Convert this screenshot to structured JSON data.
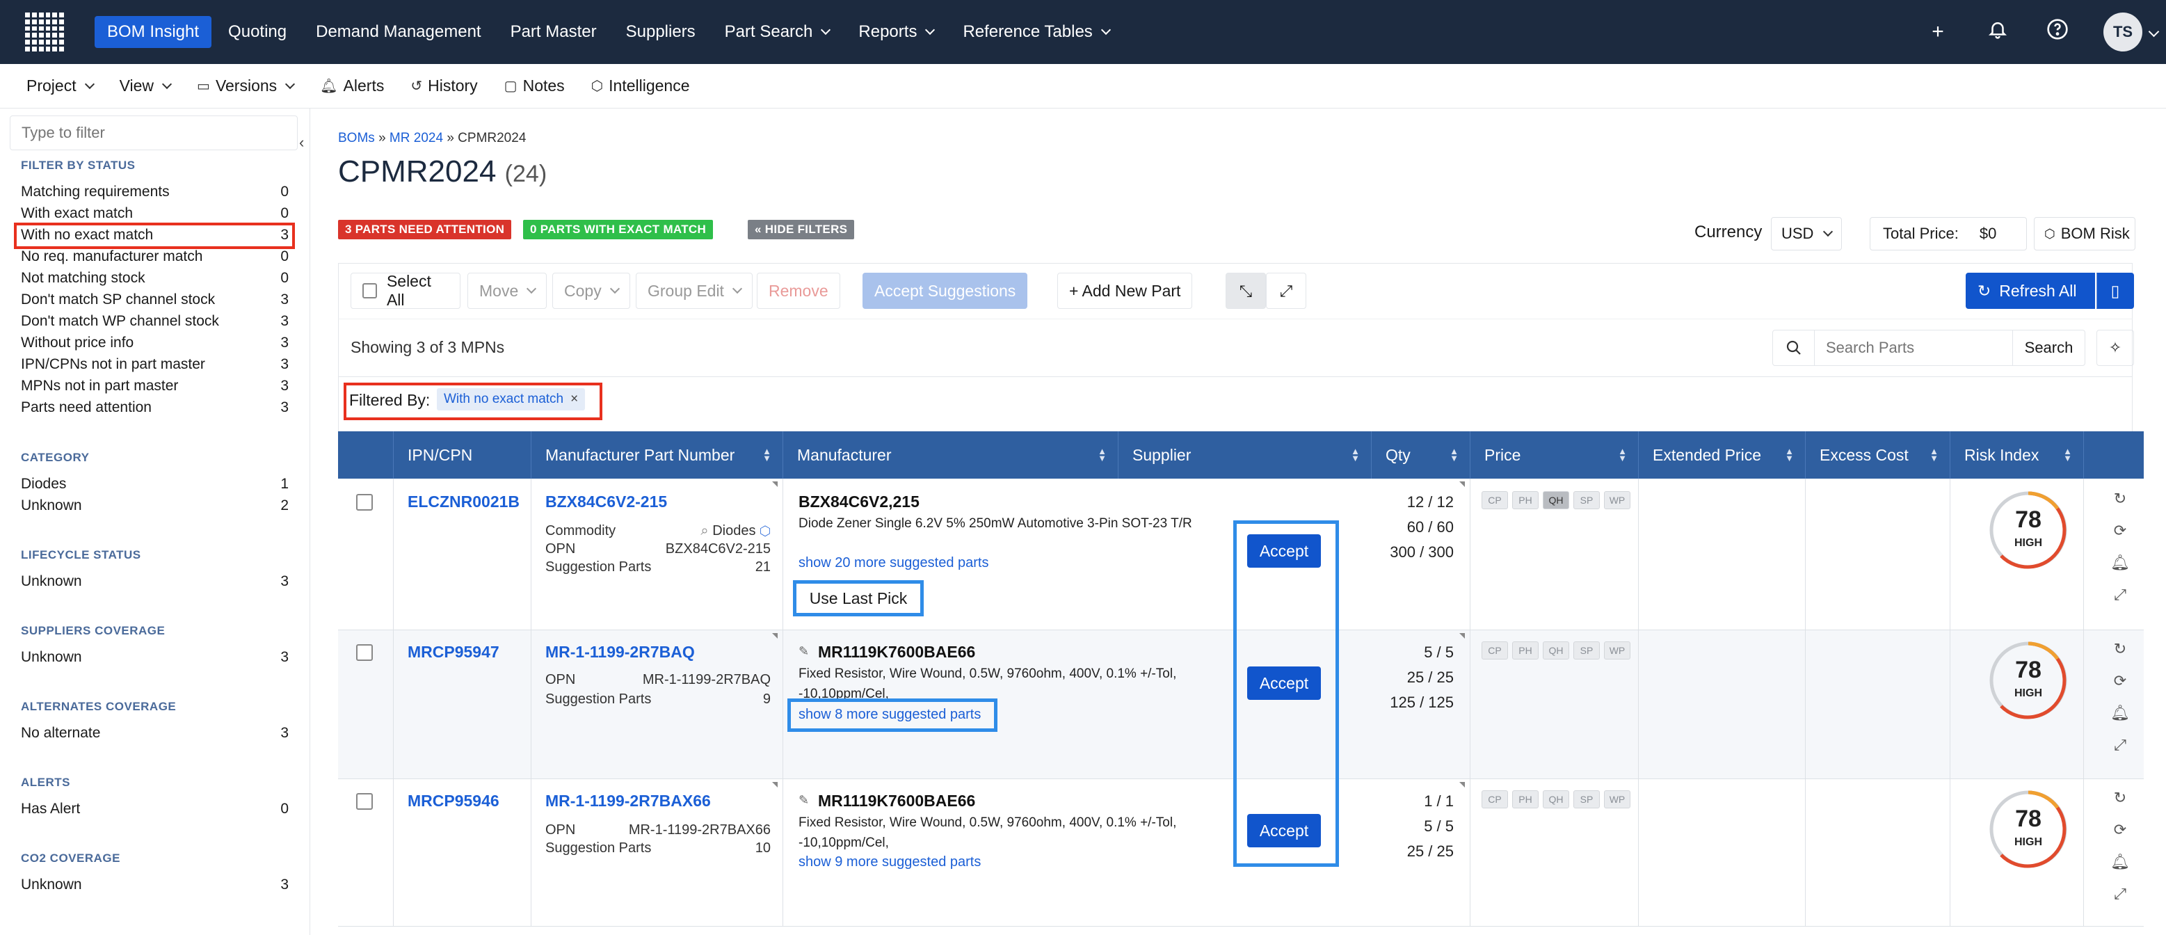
{
  "nav": {
    "items": [
      {
        "label": "BOM Insight",
        "active": true
      },
      {
        "label": "Quoting"
      },
      {
        "label": "Demand Management"
      },
      {
        "label": "Part Master"
      },
      {
        "label": "Suppliers"
      },
      {
        "label": "Part Search",
        "dropdown": true
      },
      {
        "label": "Reports",
        "dropdown": true
      },
      {
        "label": "Reference Tables",
        "dropdown": true
      }
    ],
    "avatar": "TS",
    "colors": {
      "bg": "#1c2a3f",
      "active": "#1b5fd6"
    }
  },
  "subnav": {
    "project": "Project",
    "view": "View",
    "versions": "Versions",
    "alerts": "Alerts",
    "history": "History",
    "notes": "Notes",
    "intelligence": "Intelligence"
  },
  "sidebar": {
    "filter_placeholder": "Type to filter",
    "status_title": "FILTER BY STATUS",
    "status": [
      {
        "label": "Matching requirements",
        "count": "0"
      },
      {
        "label": "With exact match",
        "count": "0"
      },
      {
        "label": "With no exact match",
        "count": "3"
      },
      {
        "label": "No req. manufacturer match",
        "count": "0"
      },
      {
        "label": "Not matching stock",
        "count": "0"
      },
      {
        "label": "Don't match SP channel stock",
        "count": "3"
      },
      {
        "label": "Don't match WP channel stock",
        "count": "3"
      },
      {
        "label": "Without price info",
        "count": "3"
      },
      {
        "label": "IPN/CPNs not in part master",
        "count": "3"
      },
      {
        "label": "MPNs not in part master",
        "count": "3"
      },
      {
        "label": "Parts need attention",
        "count": "3"
      }
    ],
    "category_title": "CATEGORY",
    "category": [
      {
        "label": "Diodes",
        "count": "1"
      },
      {
        "label": "Unknown",
        "count": "2"
      }
    ],
    "lifecycle_title": "LIFECYCLE STATUS",
    "lifecycle": [
      {
        "label": "Unknown",
        "count": "3"
      }
    ],
    "suppliers_title": "SUPPLIERS COVERAGE",
    "suppliers": [
      {
        "label": "Unknown",
        "count": "3"
      }
    ],
    "alternates_title": "ALTERNATES COVERAGE",
    "alternates": [
      {
        "label": "No alternate",
        "count": "3"
      }
    ],
    "alerts_title": "ALERTS",
    "alerts": [
      {
        "label": "Has Alert",
        "count": "0"
      }
    ],
    "co2_title": "CO2 COVERAGE",
    "co2": [
      {
        "label": "Unknown",
        "count": "3"
      }
    ]
  },
  "breadcrumb": {
    "bom": "BOMs",
    "sep": "»",
    "project": "MR 2024",
    "current": "CPMR2024"
  },
  "page": {
    "title": "CPMR2024",
    "count": "(24)",
    "badge_attention": "3 PARTS NEED ATTENTION",
    "badge_exact": "0 PARTS WITH EXACT MATCH",
    "badge_hide": "« HIDE FILTERS",
    "currency_label": "Currency",
    "currency_value": "USD",
    "total_label": "Total Price:",
    "total_value": "$0",
    "bom_risk": "BOM Risk"
  },
  "toolbar": {
    "select_all": "Select All",
    "move": "Move",
    "copy": "Copy",
    "group_edit": "Group Edit",
    "remove": "Remove",
    "accept_suggestions": "Accept Suggestions",
    "add_new_part": "+ Add New Part",
    "refresh_all": "Refresh All"
  },
  "results": {
    "showing": "Showing 3 of 3 MPNs",
    "search_placeholder": "Search Parts",
    "search_button": "Search",
    "filtered_by": "Filtered By:",
    "filter_chip": "With no exact match",
    "filter_chip_close": "×"
  },
  "table": {
    "headers": [
      "IPN/CPN",
      "Manufacturer Part Number",
      "Manufacturer",
      "Supplier",
      "Qty",
      "Price",
      "Extended Price",
      "Excess Cost",
      "Risk Index"
    ],
    "pill_labels": [
      "CP",
      "PH",
      "QH",
      "SP",
      "WP"
    ],
    "accept_label": "Accept",
    "rows": [
      {
        "ipn": "ELCZNR0021B",
        "mpn": "BZX84C6V2-215",
        "commodity_label": "Commodity",
        "commodity_value": "Diodes",
        "opn_label": "OPN",
        "opn_value": "BZX84C6V2-215",
        "sugg_label": "Suggestion Parts",
        "sugg_value": "21",
        "mfr_name": "BZX84C6V2,215",
        "desc": "Diode Zener Single 6.2V 5% 250mW Automotive 3-Pin SOT-23 T/R",
        "more": "show 20 more suggested parts",
        "last_pick": "Use Last Pick",
        "qty": [
          "12 / 12",
          "60 / 60",
          "300 / 300"
        ],
        "risk_score": "78",
        "risk_level": "HIGH"
      },
      {
        "ipn": "MRCP95947",
        "mpn": "MR-1-1199-2R7BAQ",
        "opn_label": "OPN",
        "opn_value": "MR-1-1199-2R7BAQ",
        "sugg_label": "Suggestion Parts",
        "sugg_value": "9",
        "mfr_name": "MR1119K7600BAE66",
        "desc": "Fixed Resistor, Wire Wound, 0.5W, 9760ohm, 400V, 0.1% +/-Tol, -10,10ppm/Cel,",
        "more": "show 8 more suggested parts",
        "qty": [
          "5 / 5",
          "25 / 25",
          "125 / 125"
        ],
        "risk_score": "78",
        "risk_level": "HIGH"
      },
      {
        "ipn": "MRCP95946",
        "mpn": "MR-1-1199-2R7BAX66",
        "opn_label": "OPN",
        "opn_value": "MR-1-1199-2R7BAX66",
        "sugg_label": "Suggestion Parts",
        "sugg_value": "10",
        "mfr_name": "MR1119K7600BAE66",
        "desc": "Fixed Resistor, Wire Wound, 0.5W, 9760ohm, 400V, 0.1% +/-Tol, -10,10ppm/Cel,",
        "more": "show 9 more suggested parts",
        "qty": [
          "1 / 1",
          "5 / 5",
          "25 / 25"
        ],
        "risk_score": "78",
        "risk_level": "HIGH"
      }
    ]
  },
  "colors": {
    "header_bg": "#2f5fa0",
    "accent_blue": "#1155cc",
    "badge_red": "#d9342b",
    "badge_green": "#2fbf4a",
    "badge_gray": "#7a7f86",
    "highlight_red": "#e8301e",
    "highlight_blue": "#2f8ce8"
  }
}
